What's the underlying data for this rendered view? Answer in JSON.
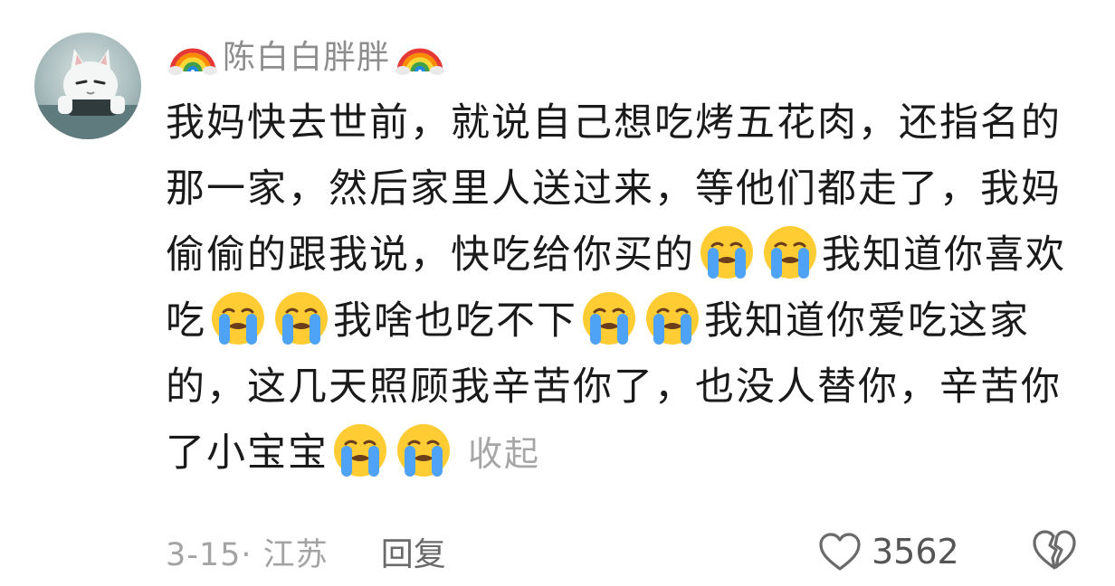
{
  "comment": {
    "username": "陈白白胖胖",
    "name_decoration_icon": "rainbow-emoji",
    "content_segments": [
      {
        "type": "text",
        "value": "我妈快去世前，就说自己想吃烤五花肉，还指名的那一家，然后家里人送过来，等他们都走了，我妈偷偷的跟我说，快吃给你买的"
      },
      {
        "type": "emoji",
        "icon": "loudly-crying-face-emoji"
      },
      {
        "type": "emoji",
        "icon": "loudly-crying-face-emoji"
      },
      {
        "type": "text",
        "value": "我知道你喜欢吃"
      },
      {
        "type": "emoji",
        "icon": "loudly-crying-face-emoji"
      },
      {
        "type": "emoji",
        "icon": "loudly-crying-face-emoji"
      },
      {
        "type": "text",
        "value": "我啥也吃不下"
      },
      {
        "type": "emoji",
        "icon": "loudly-crying-face-emoji"
      },
      {
        "type": "emoji",
        "icon": "loudly-crying-face-emoji"
      },
      {
        "type": "text",
        "value": "我知道你爱吃这家的，这几天照顾我辛苦你了，也没人替你，辛苦你了小宝宝"
      },
      {
        "type": "emoji",
        "icon": "loudly-crying-face-emoji"
      },
      {
        "type": "emoji",
        "icon": "loudly-crying-face-emoji"
      }
    ],
    "collapse_label": "收起",
    "date_location": "3-15· 江苏",
    "reply_label": "回复",
    "like_icon": "heart-outline-icon",
    "like_count": "3562",
    "dislike_icon": "broken-heart-outline-icon"
  },
  "colors": {
    "text_primary": "#1a1a1a",
    "username": "#8d8d8d",
    "meta": "#a3a3a3",
    "reply": "#6a6a6a",
    "collapse": "#a6a6a6"
  }
}
